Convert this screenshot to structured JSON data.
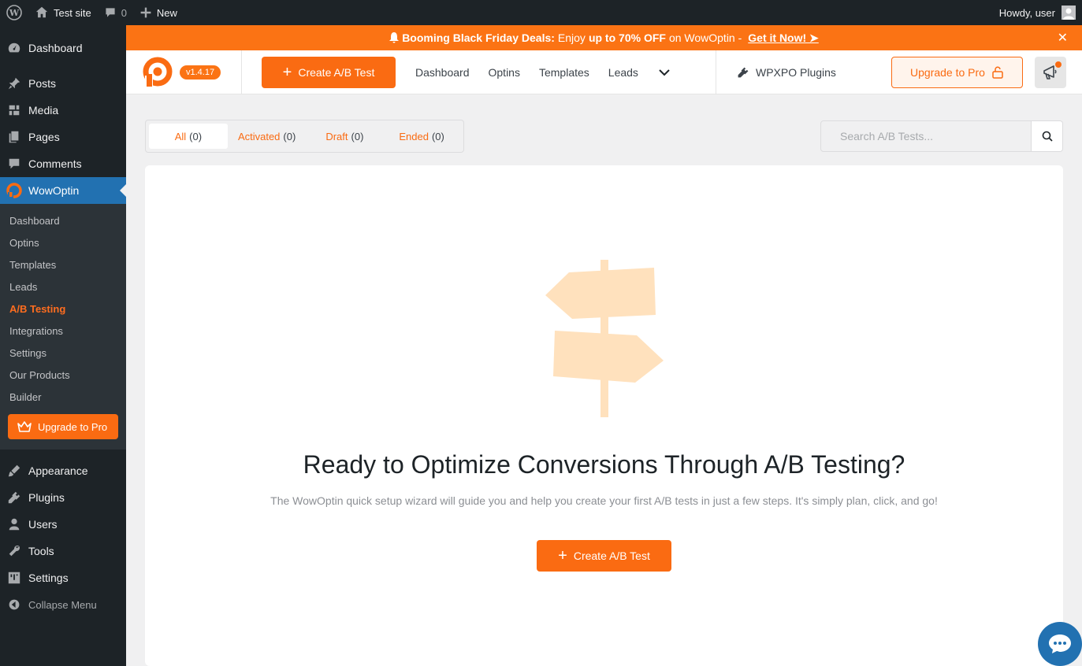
{
  "adminbar": {
    "site_name": "Test site",
    "comments_count": "0",
    "new_label": "New",
    "howdy": "Howdy, user",
    "icons": [
      "wordpress-logo-icon",
      "home-icon",
      "comment-icon",
      "plus-icon",
      "avatar-icon"
    ]
  },
  "sidebar": {
    "top_items": [
      {
        "label": "Dashboard",
        "icon": "dashboard-icon"
      },
      {
        "label": "Posts",
        "icon": "pin-icon"
      },
      {
        "label": "Media",
        "icon": "media-icon"
      },
      {
        "label": "Pages",
        "icon": "pages-icon"
      },
      {
        "label": "Comments",
        "icon": "comment-icon"
      }
    ],
    "current": {
      "label": "WowOptin",
      "icon": "wowoptin-icon"
    },
    "submenu": [
      "Dashboard",
      "Optins",
      "Templates",
      "Leads",
      "A/B Testing",
      "Integrations",
      "Settings",
      "Our Products",
      "Builder"
    ],
    "active_sub": "A/B Testing",
    "upgrade_label": "Upgrade to Pro",
    "bottom_items": [
      {
        "label": "Appearance",
        "icon": "brush-icon"
      },
      {
        "label": "Plugins",
        "icon": "plugin-icon"
      },
      {
        "label": "Users",
        "icon": "user-icon"
      },
      {
        "label": "Tools",
        "icon": "wrench-icon"
      },
      {
        "label": "Settings",
        "icon": "settings-icon"
      }
    ],
    "collapse_label": "Collapse Menu"
  },
  "promo": {
    "bold_lead": "Booming Black Friday Deals:",
    "text1": "Enjoy",
    "bold_mid": "up to 70% OFF",
    "text2": "on WowOptin -",
    "cta": "Get it Now!  ➤",
    "close": "✕"
  },
  "topnav": {
    "version": "v1.4.17",
    "create_label": "Create A/B Test",
    "links": [
      "Dashboard",
      "Optins",
      "Templates",
      "Leads"
    ],
    "wpxpo_label": "WPXPO Plugins",
    "upgrade_label": "Upgrade to Pro"
  },
  "filters": {
    "tabs": [
      {
        "label": "All",
        "count": "(0)"
      },
      {
        "label": "Activated",
        "count": "(0)"
      },
      {
        "label": "Draft",
        "count": "(0)"
      },
      {
        "label": "Ended",
        "count": "(0)"
      }
    ],
    "active": "All",
    "search_placeholder": "Search A/B Tests..."
  },
  "empty_state": {
    "title": "Ready to Optimize Conversions Through A/B Testing?",
    "description": "The WowOptin quick setup wizard will guide you and help you create your first A/B tests in just a few steps. It's simply plan, click, and go!",
    "button_label": "Create A/B Test"
  },
  "colors": {
    "accent": "#fa6b12",
    "admin_dark": "#1d2327",
    "wp_blue": "#2271b1",
    "illustration": "#ffe1bd"
  }
}
